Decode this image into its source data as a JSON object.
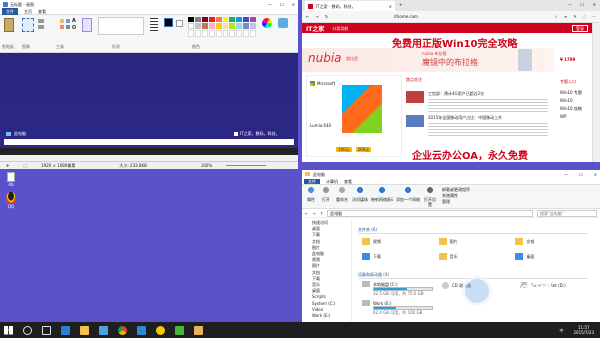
{
  "paint": {
    "title": "无标题 - 画图",
    "tabs": [
      "文件",
      "主页",
      "查看"
    ],
    "groups": [
      "剪贴板",
      "图像",
      "工具",
      "形状",
      "颜色"
    ],
    "status_size": "1920 × 1080像素",
    "status_file": "大小: 233.8KB",
    "zoom": "100%",
    "thumb_logo": "此电脑",
    "thumb_brand": "IT之家，数码，科技，"
  },
  "browser": {
    "tab_title": "IT之家 - 数码，科技，",
    "url": "ithome.com",
    "site_logo": "IT之家",
    "site_nav": "分类导航",
    "login": "登录",
    "banner_title": "免费用正版Win10完全攻略",
    "banner_brand": "nubia",
    "banner_brand2": "努比亚",
    "banner_sub": "魔镜中的布拉格",
    "banner_badge": "nubia 布拉格",
    "price": "¥ 1799",
    "ms_brand": "Microsoft",
    "lumia": "Lumia 640",
    "promo_100": "100元",
    "promo_200": "200元",
    "news_header": "焦点关注",
    "headline_1": "工信部：预计4G用户已超过2亿",
    "headline_2": "2015年全国移动用户占比：中国移动上升",
    "right_header": "专题入口",
    "right_items": [
      "Win10 专题",
      "Win10",
      "Win10 攻略",
      "WP"
    ],
    "bottom_banner": "企业云办公OA，永久免费"
  },
  "explorer": {
    "title": "此电脑",
    "tabs": [
      "文件",
      "计算机",
      "查看"
    ],
    "ribbon_buttons": [
      "属性",
      "打开",
      "重命名",
      "访问媒体",
      "映射网络驱动器",
      "添加一个网络位置",
      "打开设置",
      "卸载或更改程序",
      "系统属性",
      "管理"
    ],
    "path": "此电脑",
    "search_placeholder": "搜索\"此电脑\"",
    "folders_header": "文件夹 (6)",
    "folders": [
      "视频",
      "图片",
      "文档",
      "下载",
      "音乐",
      "桌面"
    ],
    "drives_header": "设备和驱动器 (4)",
    "drives": [
      {
        "name": "本地磁盘 (C:)",
        "free": "32.5 GB 可用，共 75.0 GB",
        "fill": 0.57
      },
      {
        "name": "Work (E:)",
        "free": "62.4 GB 可用，共 100 GB",
        "fill": 0.38
      }
    ],
    "dvd": "CD 驱动器",
    "drive_other": "Supermarket (D:)",
    "nav": [
      "快速访问",
      "桌面",
      "下载",
      "文档",
      "图片",
      "此电脑",
      "视频",
      "图片",
      "文档",
      "下载",
      "音乐",
      "桌面",
      "Scripts",
      "System (C:)",
      "Video",
      "Work (E:)"
    ]
  },
  "desktop": {
    "icons": [
      "Ab",
      "QQ"
    ]
  },
  "taskbar": {
    "time": "11:57",
    "date": "2015/7/23",
    "lang": "中"
  },
  "watermark": {
    "text": "系统城",
    "url": "XITONGCHENG.COM"
  },
  "colors": {
    "desktop": "#5a52c8",
    "ms_blue": "#2b579a",
    "ithome_red": "#d0021b",
    "paint_canvas": "#2b2680"
  }
}
